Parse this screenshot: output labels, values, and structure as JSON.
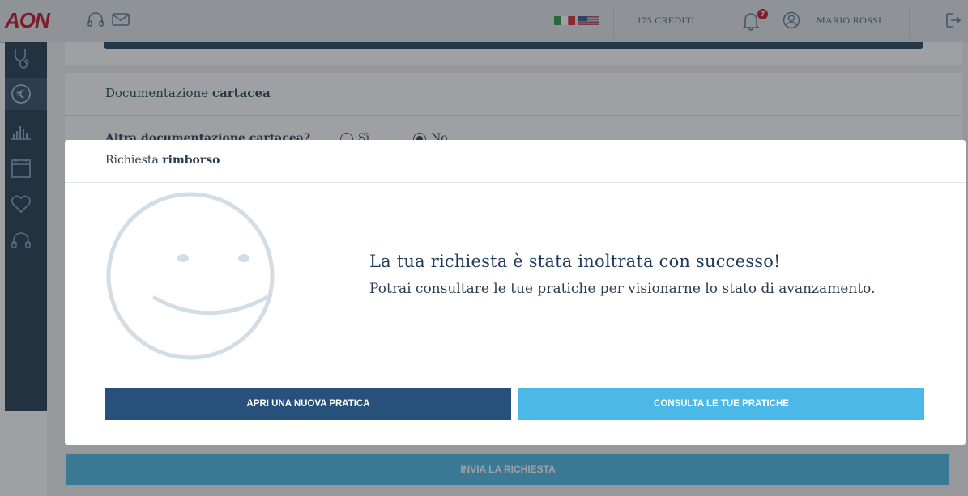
{
  "header": {
    "logo": "AON",
    "credits": "175 CREDITI",
    "notifications_count": "7",
    "user_name": "MARIO ROSSI"
  },
  "sidebar": {
    "items": [
      {
        "icon": "stethoscope-icon"
      },
      {
        "icon": "euro-refund-icon",
        "active": true
      },
      {
        "icon": "bar-chart-icon"
      },
      {
        "icon": "calendar-icon"
      },
      {
        "icon": "heart-icon"
      },
      {
        "icon": "headset-icon"
      }
    ]
  },
  "page": {
    "section_title_prefix": "Documentazione",
    "section_title_bold": "cartacea",
    "question": "Altra documentazione cartacea?",
    "option_yes": "Sì",
    "option_no": "No",
    "submit_label": "INVIA LA RICHIESTA"
  },
  "modal": {
    "title_prefix": "Richiesta",
    "title_bold": "rimborso",
    "message_title": "La tua richiesta è stata inoltrata con successo!",
    "message_body": "Potrai consultare le tue pratiche per visionarne lo stato di avanzamento.",
    "primary_button": "APRI UNA NUOVA PRATICA",
    "secondary_button": "CONSULTA LE TUE PRATICHE"
  },
  "colors": {
    "brand_red": "#c01020",
    "navy": "#27507a",
    "light_blue": "#4bb8e8"
  }
}
